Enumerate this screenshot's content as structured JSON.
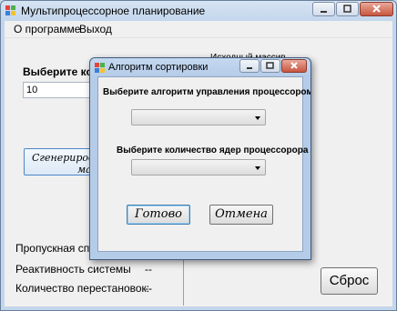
{
  "window": {
    "title": "Мультипроцессорное  планирование"
  },
  "menu": [
    {
      "label": "О программе"
    },
    {
      "label": "Выход"
    }
  ],
  "main": {
    "source_array_label": "Исходный массив",
    "choose_count_label": "Выберите количество",
    "count_value": "10",
    "generate_button_line1": "Сгенерировать массив",
    "generate_button_line2": "массив",
    "throughput_label": "Пропускная способность",
    "reactivity_label": "Реактивность системы",
    "reactivity_value": "--",
    "permutations_label": "Количество перестановок:",
    "permutations_value": "--",
    "reset_button": "Сброс"
  },
  "dialog": {
    "title": "Алгоритм сортировки",
    "algorithm_label": "Выберите алгоритм управления процессором",
    "algorithm_value": "",
    "cores_label": "Выберите количество ядер процессорора",
    "cores_value": "",
    "ok_button": "Готово",
    "cancel_button": "Отмена"
  },
  "colors": {
    "accent": "#3c7fb1",
    "close": "#c8553e"
  }
}
